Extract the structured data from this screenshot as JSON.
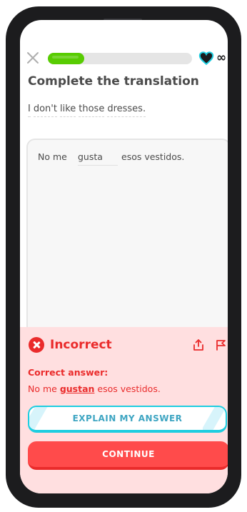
{
  "header": {
    "progress_fraction": 0.25,
    "hearts_label": "∞"
  },
  "exercise": {
    "title": "Complete the translation",
    "prompt_words": [
      "I",
      "don't",
      "like",
      "those",
      "dresses."
    ],
    "answer_prefix": "No me",
    "answer_input_value": "gusta",
    "answer_suffix": "esos vestidos."
  },
  "feedback": {
    "status": "Incorrect",
    "correct_answer_label": "Correct answer:",
    "correct_prefix": "No me",
    "correct_word": "gustan",
    "correct_suffix": "esos vestidos.",
    "explain_button": "EXPLAIN MY ANSWER",
    "continue_button": "CONTINUE"
  },
  "icons": {
    "close": "close-icon",
    "heart": "heart-icon",
    "error": "x-circle-icon",
    "share": "share-icon",
    "flag": "flag-icon"
  },
  "colors": {
    "progress": "#58cc02",
    "error": "#ea2b2b",
    "feedback_bg": "#ffdfe0",
    "explain_border": "#1ecde0",
    "continue_bg": "#ff4b4b",
    "heart": "#1ecde0"
  }
}
